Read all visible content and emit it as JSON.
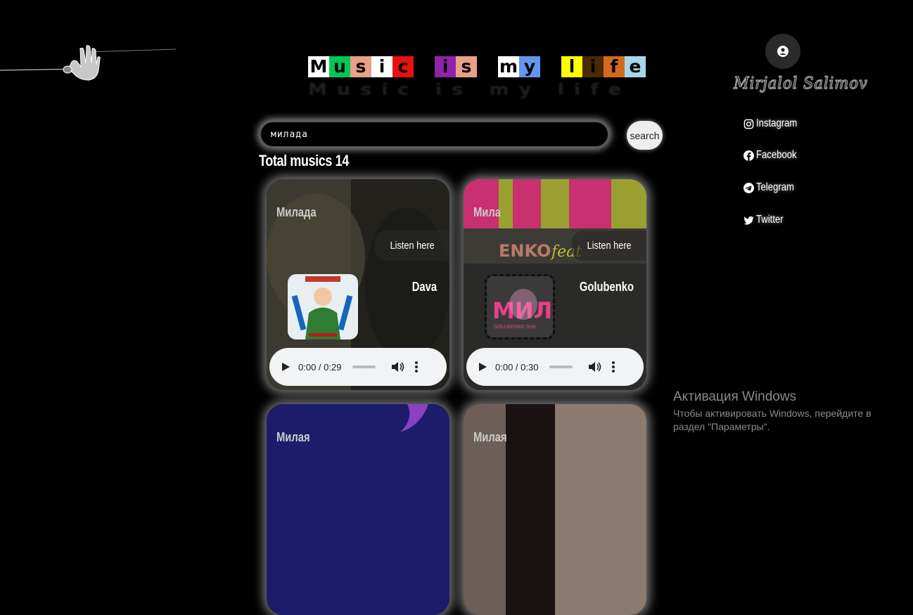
{
  "header": {
    "title_letters": [
      {
        "char": "M",
        "bg": "#ffffff"
      },
      {
        "char": "u",
        "bg": "#00c853"
      },
      {
        "char": "s",
        "bg": "#e8a088"
      },
      {
        "char": "i",
        "bg": "#ffffff"
      },
      {
        "char": "c",
        "bg": "#e81010"
      },
      {
        "char": " ",
        "bg": "#000000"
      },
      {
        "char": "i",
        "bg": "#8e24aa"
      },
      {
        "char": "s",
        "bg": "#e8a088"
      },
      {
        "char": " ",
        "bg": "#000000"
      },
      {
        "char": "m",
        "bg": "#ffffff"
      },
      {
        "char": "y",
        "bg": "#6495ed"
      },
      {
        "char": " ",
        "bg": "#000000"
      },
      {
        "char": "l",
        "bg": "#ffff00"
      },
      {
        "char": "i",
        "bg": "#4a2a00"
      },
      {
        "char": "f",
        "bg": "#d2691e"
      },
      {
        "char": "e",
        "bg": "#a8d8e8"
      }
    ],
    "title_shadow": "Music is my life"
  },
  "search": {
    "value": "милада",
    "button_label": "search"
  },
  "total_label": "Total musics 14",
  "cards": [
    {
      "title": "Милада",
      "listen_label": "Listen here",
      "artist": "Dava",
      "time": "0:00 / 0:29",
      "progress": 0,
      "bg": "#3a3a30"
    },
    {
      "title": "Мила",
      "listen_label": "Listen here",
      "artist": "Golubenko",
      "time": "0:00 / 0:30",
      "progress": 0,
      "bg": "#4a4a40"
    },
    {
      "title": "Милая",
      "bg": "#1a1a60"
    },
    {
      "title": "Милая",
      "bg": "#6a5a58"
    }
  ],
  "sidebar": {
    "signature": "Mirjalol Salimov",
    "links": [
      {
        "label": "Instagram",
        "icon": "instagram-icon"
      },
      {
        "label": "Facebook",
        "icon": "facebook-icon"
      },
      {
        "label": "Telegram",
        "icon": "telegram-icon"
      },
      {
        "label": "Twitter",
        "icon": "twitter-icon"
      }
    ]
  },
  "windows_activation": {
    "title": "Активация Windows",
    "subtitle": "Чтобы активировать Windows, перейдите в раздел \"Параметры\"."
  }
}
